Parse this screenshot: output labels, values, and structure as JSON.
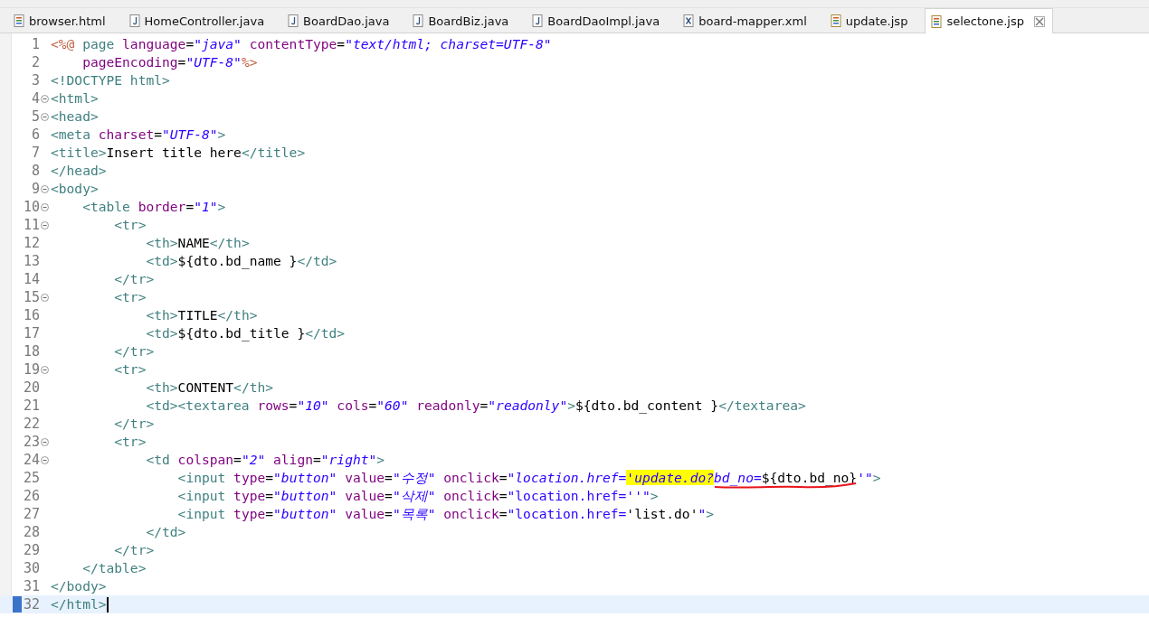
{
  "tabs": [
    {
      "label": "browser.html",
      "kind": "html",
      "selected": false
    },
    {
      "label": "HomeController.java",
      "kind": "java",
      "selected": false
    },
    {
      "label": "BoardDao.java",
      "kind": "java",
      "selected": false
    },
    {
      "label": "BoardBiz.java",
      "kind": "java",
      "selected": false
    },
    {
      "label": "BoardDaoImpl.java",
      "kind": "java",
      "selected": false
    },
    {
      "label": "board-mapper.xml",
      "kind": "xml",
      "selected": false
    },
    {
      "label": "update.jsp",
      "kind": "jsp",
      "selected": false
    },
    {
      "label": "selectone.jsp",
      "kind": "jsp",
      "selected": true
    }
  ],
  "editor": {
    "lines": [
      {
        "number": "1",
        "fold": false,
        "current": false,
        "tokens": [
          {
            "kind": "jsp",
            "text": "<%@"
          },
          {
            "kind": "tag",
            "text": " page "
          },
          {
            "kind": "attr",
            "text": "language"
          },
          {
            "kind": "text",
            "text": "="
          },
          {
            "kind": "str",
            "text": "\"java\""
          },
          {
            "kind": "attr",
            "text": " contentType"
          },
          {
            "kind": "text",
            "text": "="
          },
          {
            "kind": "str",
            "text": "\"text/html; charset=UTF-8\""
          }
        ]
      },
      {
        "number": "2",
        "fold": false,
        "current": false,
        "tokens": [
          {
            "kind": "attr",
            "text": "    pageEncoding"
          },
          {
            "kind": "text",
            "text": "="
          },
          {
            "kind": "str",
            "text": "\"UTF-8\""
          },
          {
            "kind": "jsp",
            "text": "%>"
          }
        ]
      },
      {
        "number": "3",
        "fold": false,
        "current": false,
        "tokens": [
          {
            "kind": "tag",
            "text": "<!DOCTYPE html>"
          }
        ]
      },
      {
        "number": "4",
        "fold": true,
        "current": false,
        "tokens": [
          {
            "kind": "tag",
            "text": "<html>"
          }
        ]
      },
      {
        "number": "5",
        "fold": true,
        "current": false,
        "tokens": [
          {
            "kind": "tag",
            "text": "<head>"
          }
        ]
      },
      {
        "number": "6",
        "fold": false,
        "current": false,
        "tokens": [
          {
            "kind": "tag",
            "text": "<meta "
          },
          {
            "kind": "attr",
            "text": "charset"
          },
          {
            "kind": "text",
            "text": "="
          },
          {
            "kind": "str",
            "text": "\"UTF-8\""
          },
          {
            "kind": "tag",
            "text": ">"
          }
        ]
      },
      {
        "number": "7",
        "fold": false,
        "current": false,
        "tokens": [
          {
            "kind": "tag",
            "text": "<title>"
          },
          {
            "kind": "text",
            "text": "Insert title here"
          },
          {
            "kind": "tag",
            "text": "</title>"
          }
        ]
      },
      {
        "number": "8",
        "fold": false,
        "current": false,
        "tokens": [
          {
            "kind": "tag",
            "text": "</head>"
          }
        ]
      },
      {
        "number": "9",
        "fold": true,
        "current": false,
        "tokens": [
          {
            "kind": "tag",
            "text": "<body>"
          }
        ]
      },
      {
        "number": "10",
        "fold": true,
        "current": false,
        "tokens": [
          {
            "kind": "tag",
            "text": "    <table "
          },
          {
            "kind": "attr",
            "text": "border"
          },
          {
            "kind": "text",
            "text": "="
          },
          {
            "kind": "str",
            "text": "\"1\""
          },
          {
            "kind": "tag",
            "text": ">"
          }
        ]
      },
      {
        "number": "11",
        "fold": true,
        "current": false,
        "tokens": [
          {
            "kind": "tag",
            "text": "        <tr>"
          }
        ]
      },
      {
        "number": "12",
        "fold": false,
        "current": false,
        "tokens": [
          {
            "kind": "tag",
            "text": "            <th>"
          },
          {
            "kind": "text",
            "text": "NAME"
          },
          {
            "kind": "tag",
            "text": "</th>"
          }
        ]
      },
      {
        "number": "13",
        "fold": false,
        "current": false,
        "tokens": [
          {
            "kind": "tag",
            "text": "            <td>"
          },
          {
            "kind": "text",
            "text": "${dto.bd_name }"
          },
          {
            "kind": "tag",
            "text": "</td>"
          }
        ]
      },
      {
        "number": "14",
        "fold": false,
        "current": false,
        "tokens": [
          {
            "kind": "tag",
            "text": "        </tr>"
          }
        ]
      },
      {
        "number": "15",
        "fold": true,
        "current": false,
        "tokens": [
          {
            "kind": "tag",
            "text": "        <tr>"
          }
        ]
      },
      {
        "number": "16",
        "fold": false,
        "current": false,
        "tokens": [
          {
            "kind": "tag",
            "text": "            <th>"
          },
          {
            "kind": "text",
            "text": "TITLE"
          },
          {
            "kind": "tag",
            "text": "</th>"
          }
        ]
      },
      {
        "number": "17",
        "fold": false,
        "current": false,
        "tokens": [
          {
            "kind": "tag",
            "text": "            <td>"
          },
          {
            "kind": "text",
            "text": "${dto.bd_title }"
          },
          {
            "kind": "tag",
            "text": "</td>"
          }
        ]
      },
      {
        "number": "18",
        "fold": false,
        "current": false,
        "tokens": [
          {
            "kind": "tag",
            "text": "        </tr>"
          }
        ]
      },
      {
        "number": "19",
        "fold": true,
        "current": false,
        "tokens": [
          {
            "kind": "tag",
            "text": "        <tr>"
          }
        ]
      },
      {
        "number": "20",
        "fold": false,
        "current": false,
        "tokens": [
          {
            "kind": "tag",
            "text": "            <th>"
          },
          {
            "kind": "text",
            "text": "CONTENT"
          },
          {
            "kind": "tag",
            "text": "</th>"
          }
        ]
      },
      {
        "number": "21",
        "fold": false,
        "current": false,
        "tokens": [
          {
            "kind": "tag",
            "text": "            <td><textarea "
          },
          {
            "kind": "attr",
            "text": "rows"
          },
          {
            "kind": "text",
            "text": "="
          },
          {
            "kind": "str",
            "text": "\"10\""
          },
          {
            "kind": "attr",
            "text": " cols"
          },
          {
            "kind": "text",
            "text": "="
          },
          {
            "kind": "str",
            "text": "\"60\""
          },
          {
            "kind": "attr",
            "text": " readonly"
          },
          {
            "kind": "text",
            "text": "="
          },
          {
            "kind": "str",
            "text": "\"readonly\""
          },
          {
            "kind": "tag",
            "text": ">"
          },
          {
            "kind": "text",
            "text": "${dto.bd_content }"
          },
          {
            "kind": "tag",
            "text": "</textarea>"
          }
        ]
      },
      {
        "number": "22",
        "fold": false,
        "current": false,
        "tokens": [
          {
            "kind": "tag",
            "text": "        </tr>"
          }
        ]
      },
      {
        "number": "23",
        "fold": true,
        "current": false,
        "tokens": [
          {
            "kind": "tag",
            "text": "        <tr>"
          }
        ]
      },
      {
        "number": "24",
        "fold": true,
        "current": false,
        "tokens": [
          {
            "kind": "tag",
            "text": "            <td "
          },
          {
            "kind": "attr",
            "text": "colspan"
          },
          {
            "kind": "text",
            "text": "="
          },
          {
            "kind": "str",
            "text": "\"2\""
          },
          {
            "kind": "attr",
            "text": " align"
          },
          {
            "kind": "text",
            "text": "="
          },
          {
            "kind": "str",
            "text": "\"right\""
          },
          {
            "kind": "tag",
            "text": ">"
          }
        ]
      },
      {
        "number": "25",
        "fold": false,
        "current": false,
        "tokens": [
          {
            "kind": "tag",
            "text": "                <input "
          },
          {
            "kind": "attr",
            "text": "type"
          },
          {
            "kind": "text",
            "text": "="
          },
          {
            "kind": "str",
            "text": "\"button\""
          },
          {
            "kind": "attr",
            "text": " value"
          },
          {
            "kind": "text",
            "text": "="
          },
          {
            "kind": "str",
            "text": "\"수정\""
          },
          {
            "kind": "attr",
            "text": " onclick"
          },
          {
            "kind": "text",
            "text": "="
          },
          {
            "kind": "str",
            "text": "\"location.href="
          },
          {
            "kind": "str",
            "text": "'update.do?",
            "highlighted": true
          },
          {
            "kind": "str",
            "text": "bd_no=",
            "underlined": true
          },
          {
            "kind": "text",
            "text": "${dto.bd_no}",
            "underlined": true
          },
          {
            "kind": "str",
            "text": "'\""
          },
          {
            "kind": "tag",
            "text": ">"
          }
        ]
      },
      {
        "number": "26",
        "fold": false,
        "current": false,
        "tokens": [
          {
            "kind": "tag",
            "text": "                <input "
          },
          {
            "kind": "attr",
            "text": "type"
          },
          {
            "kind": "text",
            "text": "="
          },
          {
            "kind": "str",
            "text": "\"button\""
          },
          {
            "kind": "attr",
            "text": " value"
          },
          {
            "kind": "text",
            "text": "="
          },
          {
            "kind": "str",
            "text": "\"삭제\""
          },
          {
            "kind": "attr",
            "text": " onclick"
          },
          {
            "kind": "text",
            "text": "="
          },
          {
            "kind": "val",
            "text": "\"location.href=''\""
          },
          {
            "kind": "tag",
            "text": ">"
          }
        ]
      },
      {
        "number": "27",
        "fold": false,
        "current": false,
        "tokens": [
          {
            "kind": "tag",
            "text": "                <input "
          },
          {
            "kind": "attr",
            "text": "type"
          },
          {
            "kind": "text",
            "text": "="
          },
          {
            "kind": "str",
            "text": "\"button\""
          },
          {
            "kind": "attr",
            "text": " value"
          },
          {
            "kind": "text",
            "text": "="
          },
          {
            "kind": "str",
            "text": "\"목록\""
          },
          {
            "kind": "attr",
            "text": " onclick"
          },
          {
            "kind": "text",
            "text": "="
          },
          {
            "kind": "val",
            "text": "\"location.href="
          },
          {
            "kind": "text",
            "text": "'list.do'"
          },
          {
            "kind": "val",
            "text": "\""
          },
          {
            "kind": "tag",
            "text": ">"
          }
        ]
      },
      {
        "number": "28",
        "fold": false,
        "current": false,
        "tokens": [
          {
            "kind": "tag",
            "text": "            </td>"
          }
        ]
      },
      {
        "number": "29",
        "fold": false,
        "current": false,
        "tokens": [
          {
            "kind": "tag",
            "text": "        </tr>"
          }
        ]
      },
      {
        "number": "30",
        "fold": false,
        "current": false,
        "tokens": [
          {
            "kind": "tag",
            "text": "    </table>"
          }
        ]
      },
      {
        "number": "31",
        "fold": false,
        "current": false,
        "tokens": [
          {
            "kind": "tag",
            "text": "</body>"
          }
        ]
      },
      {
        "number": "32",
        "fold": false,
        "current": true,
        "tokens": [
          {
            "kind": "tag",
            "text": "</html>"
          }
        ]
      }
    ]
  }
}
